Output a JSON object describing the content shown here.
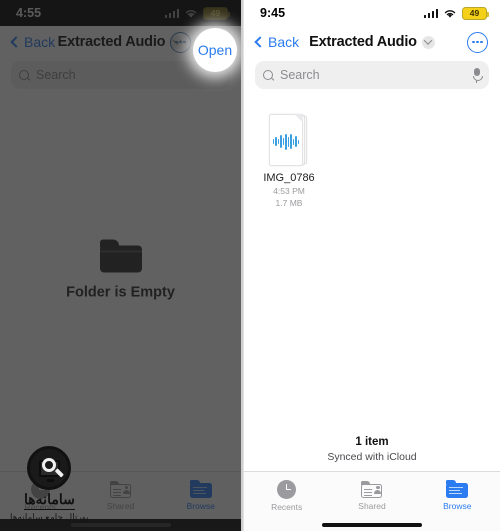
{
  "left_phone": {
    "status_bar": {
      "time": "4:55",
      "battery_level": "49",
      "wifi_icon": "wifi-icon"
    },
    "nav": {
      "back_label": "Back",
      "title": "Extracted Audio",
      "dropdown_icon": "chevron-down-icon",
      "more_icon": "ellipsis-icon",
      "open_label": "Open"
    },
    "search": {
      "placeholder": "Search",
      "search_icon": "search-icon"
    },
    "empty_state": {
      "icon": "folder-icon",
      "message": "Folder is Empty"
    },
    "tabs": [
      {
        "label": "Recents",
        "icon": "clock-icon",
        "active": false
      },
      {
        "label": "Shared",
        "icon": "shared-folder-icon",
        "active": false
      },
      {
        "label": "Browse",
        "icon": "folder-icon",
        "active": true
      }
    ]
  },
  "right_phone": {
    "status_bar": {
      "time": "9:45",
      "battery_level": "49",
      "wifi_icon": "wifi-icon"
    },
    "nav": {
      "back_label": "Back",
      "title": "Extracted Audio",
      "dropdown_icon": "chevron-down-icon",
      "more_icon": "ellipsis-icon"
    },
    "search": {
      "placeholder": "Search",
      "search_icon": "search-icon",
      "mic_icon": "microphone-icon"
    },
    "files": [
      {
        "name": "IMG_0786",
        "time": "4:53 PM",
        "size": "1.7 MB",
        "icon": "audio-waveform-document-icon"
      }
    ],
    "footer": {
      "item_count": "1 item",
      "sync_status": "Synced with iCloud"
    },
    "tabs": [
      {
        "label": "Recents",
        "icon": "clock-icon",
        "active": false
      },
      {
        "label": "Shared",
        "icon": "shared-folder-icon",
        "active": false
      },
      {
        "label": "Browse",
        "icon": "folder-icon",
        "active": true
      }
    ]
  },
  "watermark": {
    "title": "سامانه‌ها",
    "subtitle": "پورتال جامع سامانه‌ها",
    "logo_icon": "monitor-magnifier-logo-icon"
  },
  "colors": {
    "accent_blue": "#2b7cf0",
    "waveform_blue": "#3c9fe0",
    "battery_yellow": "#f5d018",
    "inactive_gray": "#9b9b9f"
  }
}
